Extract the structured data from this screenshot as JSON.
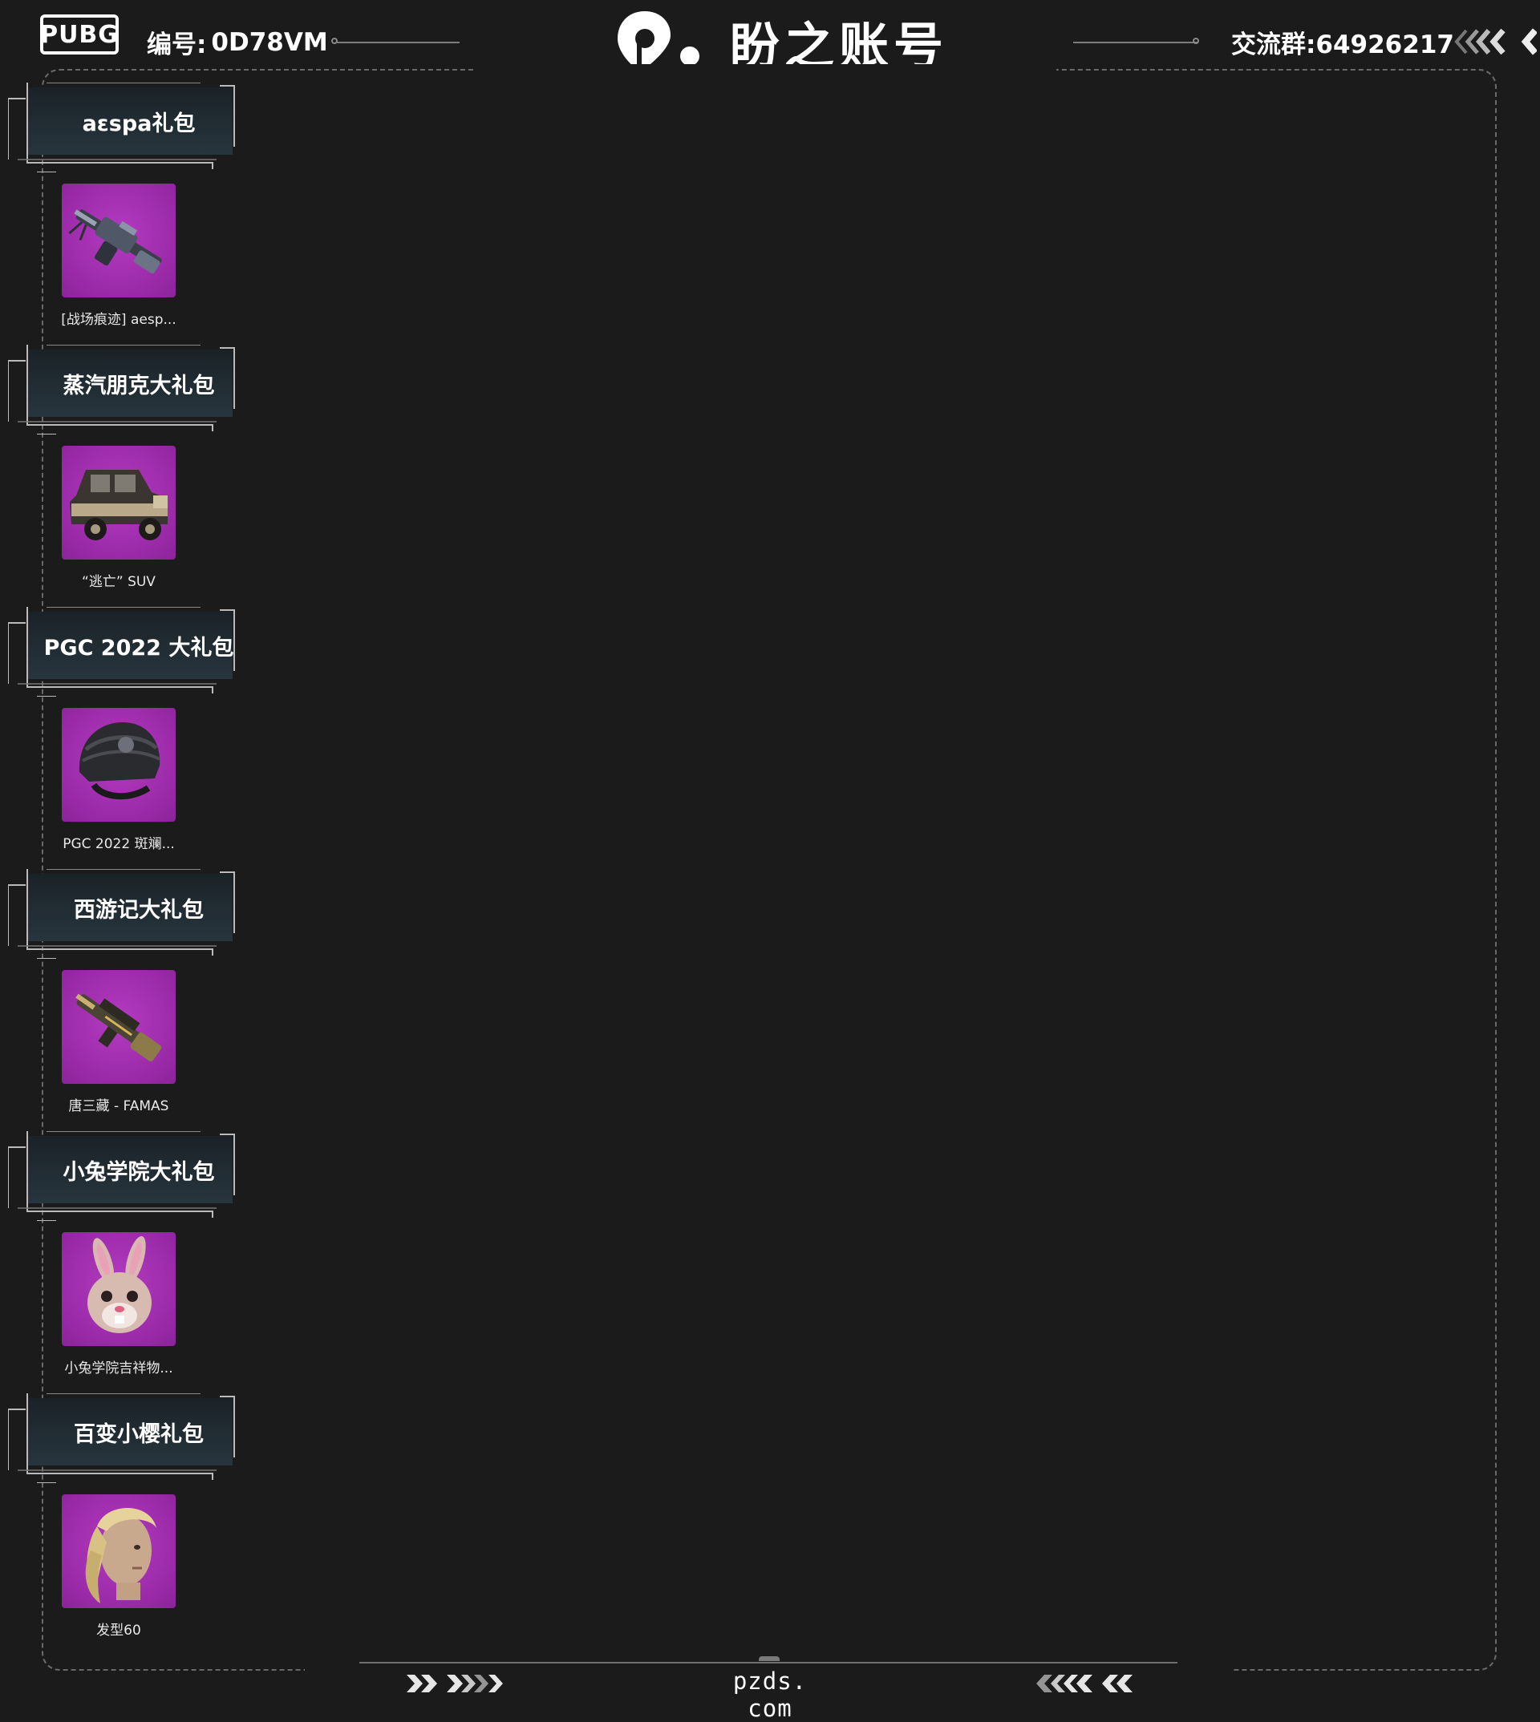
{
  "header": {
    "logo_text": "PUBG",
    "serial_label": "编号:",
    "serial_value": "0D78VM",
    "brand_name": "盼之账号",
    "group_label": "交流群:",
    "group_value": "64926217"
  },
  "packages": [
    {
      "title": "aεspa礼包",
      "item": "[战场痕迹] aesp...",
      "icon": "machine-gun-icon"
    },
    {
      "title": "蒸汽朋克大礼包",
      "item": "“逃亡” SUV",
      "icon": "vintage-car-icon"
    },
    {
      "title": "PGC 2022 大礼包",
      "item": "PGC 2022 斑斓...",
      "icon": "helmet-icon"
    },
    {
      "title": "西游记大礼包",
      "item": "唐三藏 - FAMAS",
      "icon": "rifle-icon"
    },
    {
      "title": "小兔学院大礼包",
      "item": "小兔学院吉祥物...",
      "icon": "bunny-mask-icon"
    },
    {
      "title": "百变小樱礼包",
      "item": "发型60",
      "icon": "hairstyle-icon"
    }
  ],
  "footer": {
    "site": "pzds. com"
  },
  "colors": {
    "background": "#1b1b1c",
    "item_bg": "#9a2aa8",
    "panel": "#1f2a32"
  }
}
